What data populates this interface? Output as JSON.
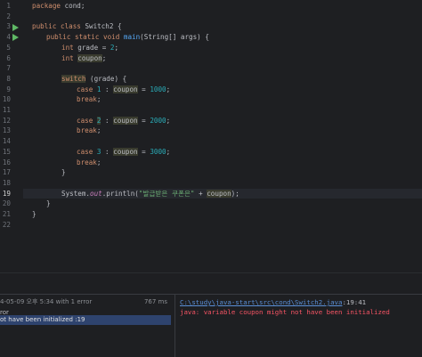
{
  "colors": {
    "background": "#1e1f22",
    "keyword": "#cf8e6d",
    "method": "#56a8f5",
    "number": "#2aacb8",
    "string": "#6aab73",
    "error": "#f75464",
    "link": "#5a8fd6",
    "selection": "#2e436e"
  },
  "icons": {
    "run": "play-triangle-icon"
  },
  "editor": {
    "current_line": "19",
    "line_numbers": [
      "1",
      "2",
      "3",
      "4",
      "5",
      "6",
      "7",
      "8",
      "9",
      "10",
      "11",
      "12",
      "13",
      "14",
      "15",
      "16",
      "17",
      "18",
      "19",
      "20",
      "21",
      "22"
    ],
    "code": {
      "l1_kw": "package",
      "l1_rest": " cond;",
      "l3_kw": "public class",
      "l3_name": " Switch2 {",
      "l4_kw": "public static void",
      "l4_fn": "main",
      "l4_rest": "(String[] args) {",
      "l5_kw": "int",
      "l5_var": " grade = ",
      "l5_num": "2",
      "l5_end": ";",
      "l6_kw": "int",
      "l6_var": "coupon",
      "l6_end": ";",
      "l8_kw": "switch",
      "l8_rest": " (grade) {",
      "l9_kw": "case",
      "l9_num": "1",
      "l9_mid": " : ",
      "l9_var": "coupon",
      "l9_eq": " = ",
      "l9_val": "1000",
      "l9_end": ";",
      "l10_kw": "break",
      "l10_end": ";",
      "l12_kw": "case",
      "l12_num": "2",
      "l12_mid": " : ",
      "l12_var": "coupon",
      "l12_eq": " = ",
      "l12_val": "2000",
      "l12_end": ";",
      "l13_kw": "break",
      "l13_end": ";",
      "l15_kw": "case",
      "l15_num": "3",
      "l15_mid": " : ",
      "l15_var": "coupon",
      "l15_eq": " = ",
      "l15_val": "3000",
      "l15_end": ";",
      "l16_kw": "break",
      "l16_end": ";",
      "l17": "}",
      "l19_pre": "System.",
      "l19_out": "out",
      "l19_mid": ".println(",
      "l19_str": "\"발급받은 쿠폰은\"",
      "l19_plus": " + ",
      "l19_var": "coupon",
      "l19_end": ");",
      "l20": "}",
      "l21": "}"
    }
  },
  "build": {
    "summary": "4-05-09 오후 5:34 with 1 error",
    "duration": "767 ms",
    "category_label": "ror",
    "error_item": "ot have been initialized :19"
  },
  "output": {
    "path": "C:\\study\\java-start\\src\\cond\\Switch2.java",
    "position": ":19:41",
    "message": "java: variable coupon might not have been initialized"
  }
}
